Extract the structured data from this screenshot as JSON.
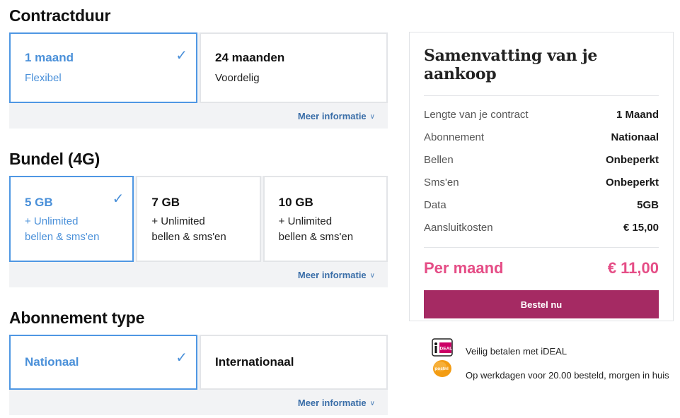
{
  "contract": {
    "title": "Contractduur",
    "options": [
      {
        "label": "1 maand",
        "sub": "Flexibel",
        "selected": true
      },
      {
        "label": "24 maanden",
        "sub": "Voordelig",
        "selected": false
      }
    ],
    "more": "Meer informatie"
  },
  "bundle": {
    "title": "Bundel (4G)",
    "options": [
      {
        "label": "5 GB",
        "sub1": "+ Unlimited",
        "sub2": "bellen & sms'en",
        "selected": true
      },
      {
        "label": "7 GB",
        "sub1": "+ Unlimited",
        "sub2": "bellen & sms'en",
        "selected": false
      },
      {
        "label": "10 GB",
        "sub1": "+ Unlimited",
        "sub2": "bellen & sms'en",
        "selected": false
      }
    ],
    "more": "Meer informatie"
  },
  "type": {
    "title": "Abonnement type",
    "options": [
      {
        "label": "Nationaal",
        "selected": true
      },
      {
        "label": "Internationaal",
        "selected": false
      }
    ],
    "more": "Meer informatie"
  },
  "summary": {
    "title": "Samenvatting van je aankoop",
    "rows": [
      {
        "key": "Lengte van je contract",
        "value": "1 Maand"
      },
      {
        "key": "Abonnement",
        "value": "Nationaal"
      },
      {
        "key": "Bellen",
        "value": "Onbeperkt"
      },
      {
        "key": "Sms'en",
        "value": "Onbeperkt"
      },
      {
        "key": "Data",
        "value": "5GB"
      },
      {
        "key": "Aansluitkosten",
        "value": "€ 15,00"
      }
    ],
    "total_label": "Per maand",
    "total_value": "€ 11,00",
    "order_button": "Bestel nu"
  },
  "info": {
    "ideal_text": "Veilig betalen met iDEAL",
    "ideal_logo_text": "iDEAL",
    "postnl_text": "Op werkdagen voor 20.00 besteld, morgen in huis",
    "postnl_logo_text": "postnl"
  },
  "icons": {
    "check": "check-icon",
    "chevron": "chevron-down-icon",
    "ideal": "ideal-logo-icon",
    "postnl": "postnl-logo-icon"
  },
  "colors": {
    "selected_border": "#4f97e3",
    "selected_text": "#4a90d9",
    "link": "#3a6ea8",
    "total": "#e54d86",
    "order_button": "#a52a63"
  }
}
